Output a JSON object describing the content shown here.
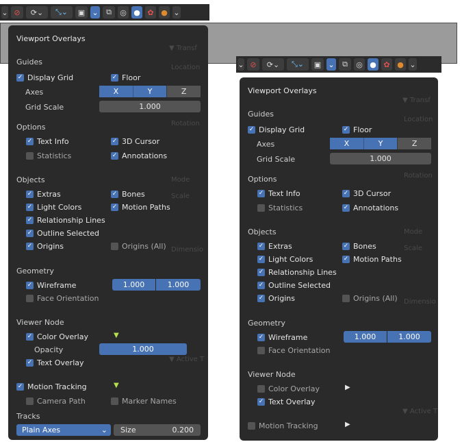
{
  "overlays": {
    "title": "Viewport Overlays",
    "guides": {
      "section": "Guides",
      "display_grid": "Display Grid",
      "floor": "Floor",
      "axes_label": "Axes",
      "axes": [
        "X",
        "Y",
        "Z"
      ],
      "grid_scale_label": "Grid Scale",
      "grid_scale": "1.000"
    },
    "options": {
      "section": "Options",
      "text_info": "Text Info",
      "cursor": "3D Cursor",
      "statistics": "Statistics",
      "annotations": "Annotations"
    },
    "objects": {
      "section": "Objects",
      "extras": "Extras",
      "bones": "Bones",
      "light_colors": "Light Colors",
      "motion_paths": "Motion Paths",
      "relationship_lines": "Relationship Lines",
      "outline_selected": "Outline Selected",
      "origins": "Origins",
      "origins_all": "Origins (All)"
    },
    "geometry": {
      "section": "Geometry",
      "wireframe": "Wireframe",
      "wire_val1": "1.000",
      "wire_val2": "1.000",
      "face_orientation": "Face Orientation"
    },
    "viewer": {
      "section": "Viewer Node",
      "color_overlay": "Color Overlay",
      "opacity_label": "Opacity",
      "opacity": "1.000",
      "text_overlay": "Text Overlay"
    },
    "tracking": {
      "motion_tracking": "Motion Tracking",
      "camera_path": "Camera Path",
      "marker_names": "Marker Names",
      "tracks_label": "Tracks",
      "tracks_value": "Plain Axes",
      "size_label": "Size",
      "size_value": "0.200"
    }
  },
  "colors": {
    "accent": "#4772b3",
    "panel": "#2a2a2a",
    "green_arrow": "#b7e04e"
  }
}
